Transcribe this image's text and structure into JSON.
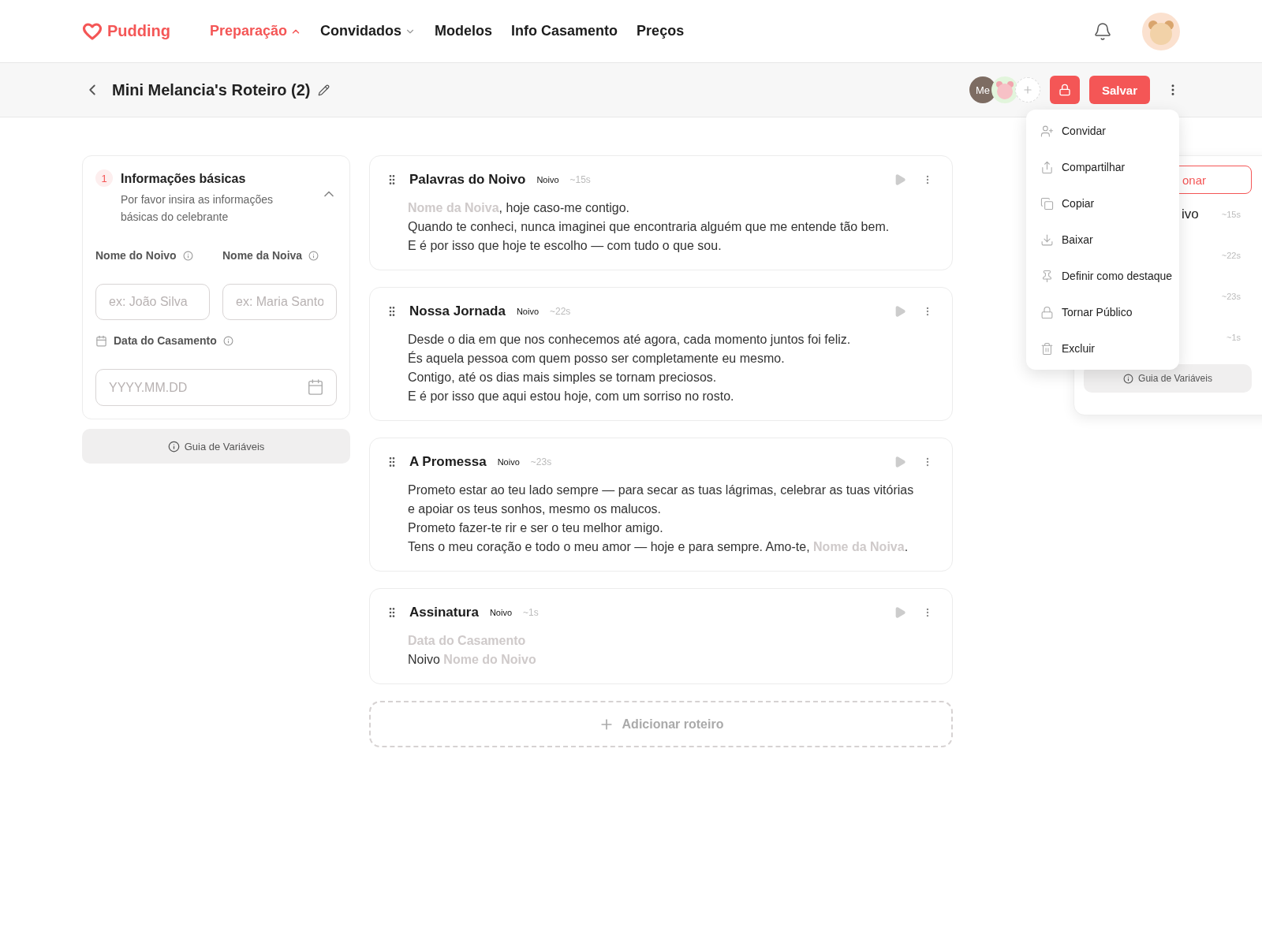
{
  "nav": {
    "logo": "Pudding",
    "items": [
      {
        "label": "Preparação",
        "selected": true,
        "dropdown": true
      },
      {
        "label": "Convidados",
        "selected": false,
        "dropdown": true
      },
      {
        "label": "Modelos",
        "selected": false,
        "dropdown": false
      },
      {
        "label": "Info Casamento",
        "selected": false,
        "dropdown": false
      },
      {
        "label": "Preços",
        "selected": false,
        "dropdown": false
      }
    ]
  },
  "toolbar": {
    "title": "Mini Melancia's Roteiro (2)",
    "collaborators": [
      {
        "kind": "initials",
        "label": "Me"
      },
      {
        "kind": "picture"
      }
    ],
    "save": "Salvar"
  },
  "basic_info": {
    "step": "1",
    "title": "Informações básicas",
    "description": "Por favor insira as informações básicas do celebrante",
    "expanded": true,
    "fields": [
      {
        "label": "Nome do Noivo",
        "placeholder": "ex: João Silva"
      },
      {
        "label": "Nome da Noiva",
        "placeholder": "ex: Maria Santo"
      }
    ],
    "date": {
      "label": "Data do Casamento",
      "placeholder": "YYYY.MM.DD"
    },
    "guide_button": "Guia de Variáveis"
  },
  "scripts": [
    {
      "title": "Palavras do Noivo",
      "role": "Noivo",
      "duration": "~15s",
      "lines": [
        [
          {
            "kind": "variable",
            "text": "Nome da Noiva"
          },
          {
            "kind": "text",
            "text": ", hoje caso-me contigo."
          }
        ],
        [
          {
            "kind": "text",
            "text": "Quando te conheci, nunca imaginei que encontraria alguém que me entende tão bem."
          }
        ],
        [
          {
            "kind": "text",
            "text": "E é por isso que hoje te escolho — com tudo o que sou."
          }
        ]
      ]
    },
    {
      "title": "Nossa Jornada",
      "role": "Noivo",
      "duration": "~22s",
      "lines": [
        [
          {
            "kind": "text",
            "text": "Desde o dia em que nos conhecemos até agora, cada momento juntos foi feliz."
          }
        ],
        [
          {
            "kind": "text",
            "text": "És aquela pessoa com quem posso ser completamente eu mesmo."
          }
        ],
        [
          {
            "kind": "text",
            "text": "Contigo, até os dias mais simples se tornam preciosos."
          }
        ],
        [
          {
            "kind": "text",
            "text": "E é por isso que aqui estou hoje, com um sorriso no rosto."
          }
        ]
      ]
    },
    {
      "title": "A Promessa",
      "role": "Noivo",
      "duration": "~23s",
      "lines": [
        [
          {
            "kind": "text",
            "text": "Prometo estar ao teu lado sempre — para secar as tuas lágrimas, celebrar as tuas vitórias"
          }
        ],
        [
          {
            "kind": "text",
            "text": "e apoiar os teus sonhos, mesmo os malucos."
          }
        ],
        [
          {
            "kind": "text",
            "text": "Prometo fazer-te rir e ser o teu melhor amigo."
          }
        ],
        [
          {
            "kind": "text",
            "text": "Tens o meu coração e todo o meu amor — hoje e para sempre. Amo-te, "
          },
          {
            "kind": "variable",
            "text": "Nome da Noiva"
          },
          {
            "kind": "text",
            "text": "."
          }
        ]
      ]
    },
    {
      "title": "Assinatura",
      "role": "Noivo",
      "duration": "~1s",
      "lines": [
        [
          {
            "kind": "variable",
            "text": "Data do Casamento"
          }
        ],
        [
          {
            "kind": "text",
            "text": "Noivo "
          },
          {
            "kind": "variable",
            "text": "Nome do Noivo"
          }
        ]
      ]
    }
  ],
  "add_button": "Adicionar roteiro",
  "side_panel": {
    "button": "onar",
    "rows": [
      {
        "title": "ivo",
        "duration": "~15s"
      },
      {
        "duration": "~22s"
      },
      {
        "duration": "~23s"
      },
      {
        "duration": "~1s"
      }
    ],
    "guide_button": "Guia de Variáveis"
  },
  "menu": {
    "items": [
      {
        "label": "Convidar"
      },
      {
        "label": "Compartilhar"
      },
      {
        "label": "Copiar"
      },
      {
        "label": "Baixar"
      },
      {
        "label": "Definir como destaque"
      },
      {
        "label": "Tornar Público"
      },
      {
        "label": "Excluir"
      }
    ]
  }
}
